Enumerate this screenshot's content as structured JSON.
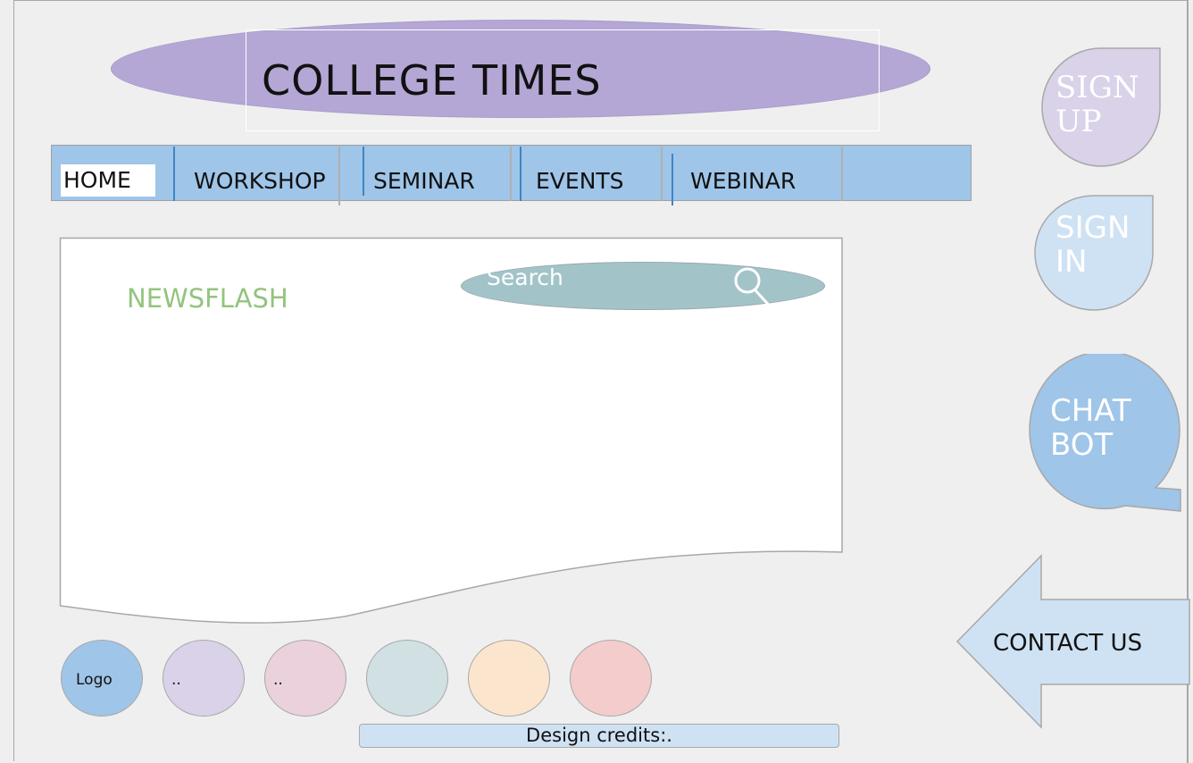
{
  "header": {
    "title": "COLLEGE TIMES"
  },
  "nav": {
    "items": [
      {
        "label": "HOME"
      },
      {
        "label": "WORKSHOP"
      },
      {
        "label": "SEMINAR"
      },
      {
        "label": "EVENTS"
      },
      {
        "label": "WEBINAR"
      }
    ]
  },
  "main": {
    "newsflash_label": "NEWSFLASH",
    "search": {
      "placeholder": "Search"
    }
  },
  "sidebar": {
    "sign_up": "SIGN\nUP",
    "sign_in": "SIGN\nIN",
    "chatbot": "CHAT\nBOT",
    "contact_us": "CONTACT US"
  },
  "footer": {
    "logo_label": "Logo",
    "circle_2_label": "..",
    "circle_3_label": "..",
    "credits": "Design credits:."
  },
  "colors": {
    "title_fill": "#b4a7d6",
    "nav_fill": "#9fc5e8",
    "newsflash_text": "#93c47d",
    "search_fill": "#a2c4c9",
    "sign_up_fill": "#d9d2e9",
    "sign_in_fill": "#cfe2f3",
    "chatbot_fill": "#9fc5e8",
    "contact_fill": "#cfe2f3"
  },
  "icons": {
    "search": "search-icon"
  }
}
